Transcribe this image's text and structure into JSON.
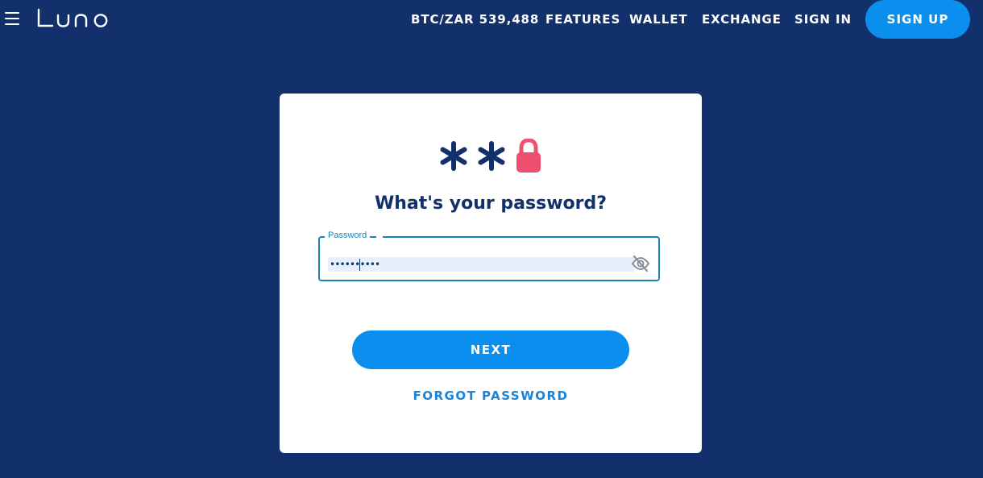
{
  "header": {
    "logo_text": "LUNO",
    "nav": [
      {
        "label": "BTC/ZAR 539,488"
      },
      {
        "label": "FEATURES"
      },
      {
        "label": "WALLET"
      },
      {
        "label": "EXCHANGE"
      },
      {
        "label": "SIGN IN"
      }
    ],
    "signup_label": "SIGN UP"
  },
  "card": {
    "title": "What's your password?",
    "field": {
      "label": "Password",
      "value": "••••••••••",
      "toggle_icon": "eye-off-icon"
    },
    "next_label": "NEXT",
    "forgot_label": "FORGOT PASSWORD"
  },
  "colors": {
    "background": "#12306b",
    "accent": "#0a8fee",
    "lock": "#ef4f6e",
    "field_border": "#1a83b5"
  }
}
